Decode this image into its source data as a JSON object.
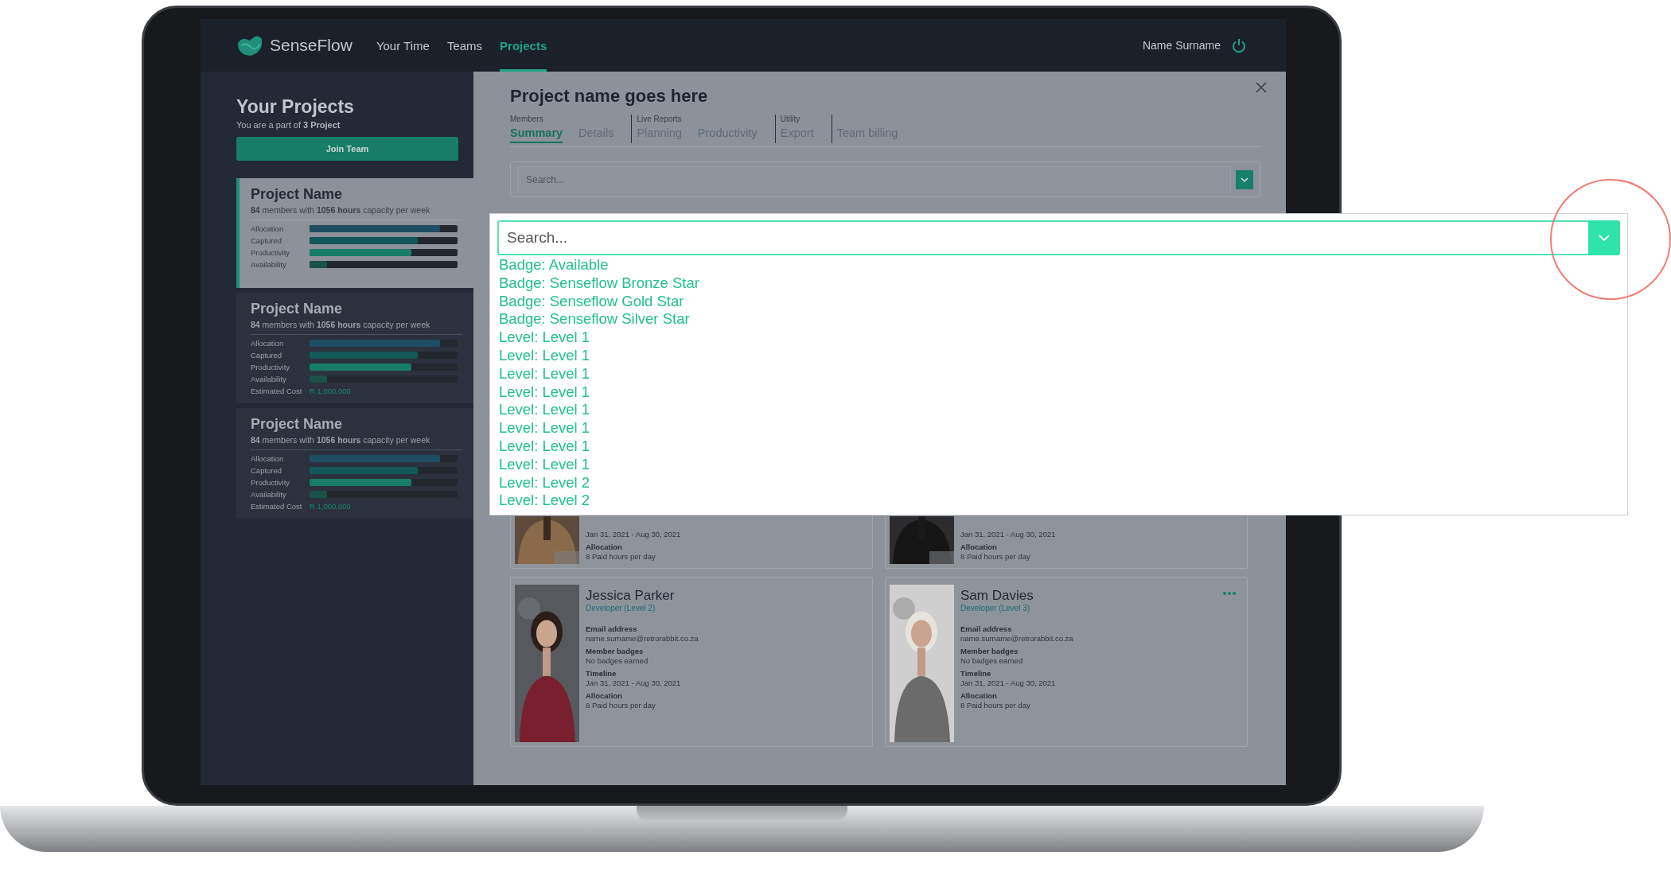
{
  "nav": {
    "brand": "Sense**Flow**",
    "links": [
      {
        "label": "Your Time",
        "selected": false
      },
      {
        "label": "Teams",
        "selected": false
      },
      {
        "label": "Projects",
        "selected": true
      }
    ],
    "user": "Name Surname"
  },
  "sidebar": {
    "title": "Your Projects",
    "subtitle": "You are a part of **3 Project**",
    "join_button": "Join Team",
    "projects": [
      {
        "name": "Project Name",
        "capacity": "**84** members with **1056 hours** capacity per week",
        "selected": true,
        "metrics": [
          {
            "label": "Allocation",
            "level": 0.88,
            "color": "#1f4d63"
          },
          {
            "label": "Captured",
            "level": 0.73,
            "color": "#15585a"
          },
          {
            "label": "Productivity",
            "level": 0.69,
            "color": "#177d66"
          },
          {
            "label": "Availability",
            "level": 0.12,
            "color": "#1a5248"
          }
        ]
      },
      {
        "name": "Project Name",
        "capacity": "**84** members with **1056 hours** capacity per week",
        "selected": false,
        "metrics": [
          {
            "label": "Allocation",
            "level": 0.88,
            "color": "#1f4d63"
          },
          {
            "label": "Captured",
            "level": 0.73,
            "color": "#15585a"
          },
          {
            "label": "Productivity",
            "level": 0.69,
            "color": "#177d66"
          },
          {
            "label": "Availability",
            "level": 0.12,
            "color": "#1a5248"
          }
        ],
        "estimated_cost": {
          "label": "Estimated Cost",
          "value": "R 1,000,000"
        }
      },
      {
        "name": "Project Name",
        "capacity": "**84** members with **1056 hours** capacity per week",
        "selected": false,
        "metrics": [
          {
            "label": "Allocation",
            "level": 0.88,
            "color": "#1f4d63"
          },
          {
            "label": "Captured",
            "level": 0.73,
            "color": "#15585a"
          },
          {
            "label": "Productivity",
            "level": 0.69,
            "color": "#177d66"
          },
          {
            "label": "Availability",
            "level": 0.12,
            "color": "#1a5248"
          }
        ],
        "estimated_cost": {
          "label": "Estimated Cost",
          "value": "R 1,000,000"
        }
      }
    ]
  },
  "modal": {
    "title": "Project name goes here",
    "tab_groups": [
      {
        "caption": "Members",
        "tabs": [
          {
            "label": "Summary",
            "selected": true
          },
          {
            "label": "Details",
            "selected": false
          }
        ]
      },
      {
        "caption": "Live Reports",
        "tabs": [
          {
            "label": "Planning",
            "selected": false
          },
          {
            "label": "Productivity",
            "selected": false
          }
        ]
      },
      {
        "caption": "Utility",
        "tabs": [
          {
            "label": "Export",
            "selected": false
          }
        ]
      },
      {
        "tabs": [
          {
            "label": "Team billing",
            "selected": false
          }
        ]
      }
    ],
    "search": {
      "placeholder": "Search..."
    },
    "members": [
      {
        "fields": [
          {
            "value": "Jan 31, 2021 - Aug 30, 2021"
          },
          {
            "label": "Allocation",
            "value": "8 Paid hours per day"
          }
        ],
        "more_menu": false
      },
      {
        "fields": [
          {
            "value": "Jan 31, 2021 - Aug 30, 2021"
          },
          {
            "label": "Allocation",
            "value": "8 Paid hours per day"
          }
        ],
        "more_menu": false
      },
      {
        "name": "Jessica Parker",
        "role": "Developer (Level 2)",
        "fields": [
          {
            "label": "Email address",
            "value": "name.surname@retrorabbit.co.za"
          },
          {
            "label": "Member badges",
            "value": "No badges earned"
          },
          {
            "label": "Timeline",
            "value": "Jan 31, 2021 - Aug 30, 2021"
          },
          {
            "label": "Allocation",
            "value": "8 Paid hours per day"
          }
        ],
        "more_menu": false
      },
      {
        "name": "Sam Davies",
        "role": "Developer (Level 3)",
        "fields": [
          {
            "label": "Email address",
            "value": "name.surname@retrorabbit.co.za"
          },
          {
            "label": "Member badges",
            "value": "No badges earned"
          },
          {
            "label": "Timeline",
            "value": "Jan 31, 2021 - Aug 30, 2021"
          },
          {
            "label": "Allocation",
            "value": "8 Paid hours per day"
          }
        ],
        "more_menu": true
      }
    ]
  },
  "dropdown": {
    "placeholder": "Search...",
    "options": [
      "Badge: Available",
      "Badge: Senseflow Bronze Star",
      "Badge: Senseflow Gold Star",
      "Badge: Senseflow Silver Star",
      "Level: Level 1",
      "Level: Level 1",
      "Level: Level 1",
      "Level: Level 1",
      "Level: Level 1",
      "Level: Level 1",
      "Level: Level 1",
      "Level: Level 1",
      "Level: Level 2",
      "Level: Level 2"
    ]
  }
}
